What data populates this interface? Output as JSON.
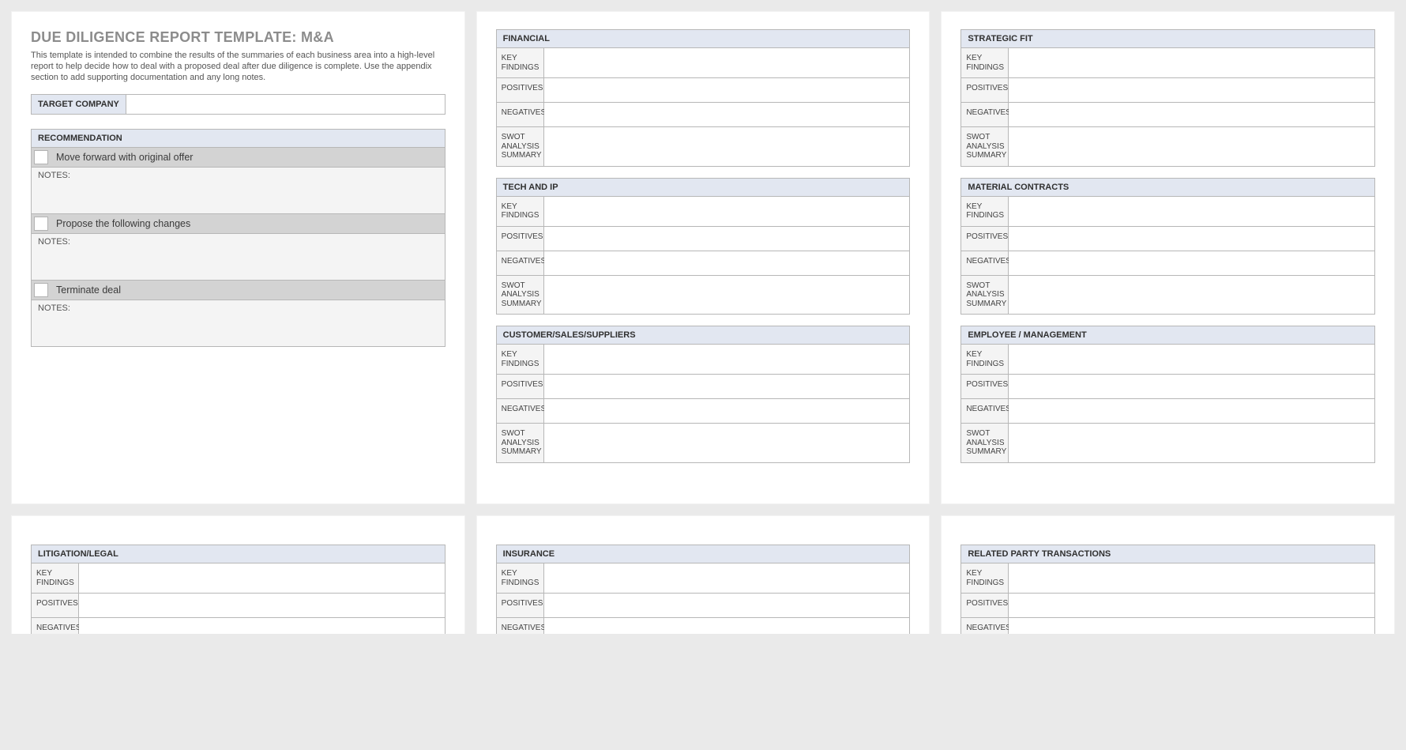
{
  "page_title": "DUE DILIGENCE REPORT TEMPLATE: M&A",
  "intro_text": "This template is intended to combine the results of the summaries of each business area into a high-level report to help decide how to deal with a proposed deal after due diligence is complete.  Use the appendix section to add supporting documentation and any long notes.",
  "target_company": {
    "label": "TARGET COMPANY",
    "value": ""
  },
  "recommendation": {
    "header": "RECOMMENDATION",
    "options": [
      {
        "label": "Move forward with original offer",
        "notes_label": "NOTES:",
        "notes": ""
      },
      {
        "label": "Propose the following changes",
        "notes_label": "NOTES:",
        "notes": ""
      },
      {
        "label": "Terminate deal",
        "notes_label": "NOTES:",
        "notes": ""
      }
    ]
  },
  "row_labels": {
    "key_findings": "KEY FINDINGS",
    "positives": "POSITIVES",
    "negatives": "NEGATIVES",
    "swot": "SWOT ANALYSIS SUMMARY"
  },
  "sections_col2_a": [
    {
      "title": "FINANCIAL",
      "key_findings": "",
      "positives": "",
      "negatives": "",
      "swot": ""
    },
    {
      "title": "TECH AND IP",
      "key_findings": "",
      "positives": "",
      "negatives": "",
      "swot": ""
    },
    {
      "title": "CUSTOMER/SALES/SUPPLIERS",
      "key_findings": "",
      "positives": "",
      "negatives": "",
      "swot": ""
    }
  ],
  "sections_col3_a": [
    {
      "title": "STRATEGIC FIT",
      "key_findings": "",
      "positives": "",
      "negatives": "",
      "swot": ""
    },
    {
      "title": "MATERIAL CONTRACTS",
      "key_findings": "",
      "positives": "",
      "negatives": "",
      "swot": ""
    },
    {
      "title": "EMPLOYEE / MANAGEMENT",
      "key_findings": "",
      "positives": "",
      "negatives": "",
      "swot": ""
    }
  ],
  "sections_col1_b": [
    {
      "title": "LITIGATION/LEGAL",
      "key_findings": "",
      "positives": "",
      "negatives": "",
      "swot": ""
    }
  ],
  "sections_col2_b": [
    {
      "title": "INSURANCE",
      "key_findings": "",
      "positives": "",
      "negatives": "",
      "swot": ""
    }
  ],
  "sections_col3_b": [
    {
      "title": "RELATED PARTY TRANSACTIONS",
      "key_findings": "",
      "positives": "",
      "negatives": "",
      "swot": ""
    }
  ]
}
